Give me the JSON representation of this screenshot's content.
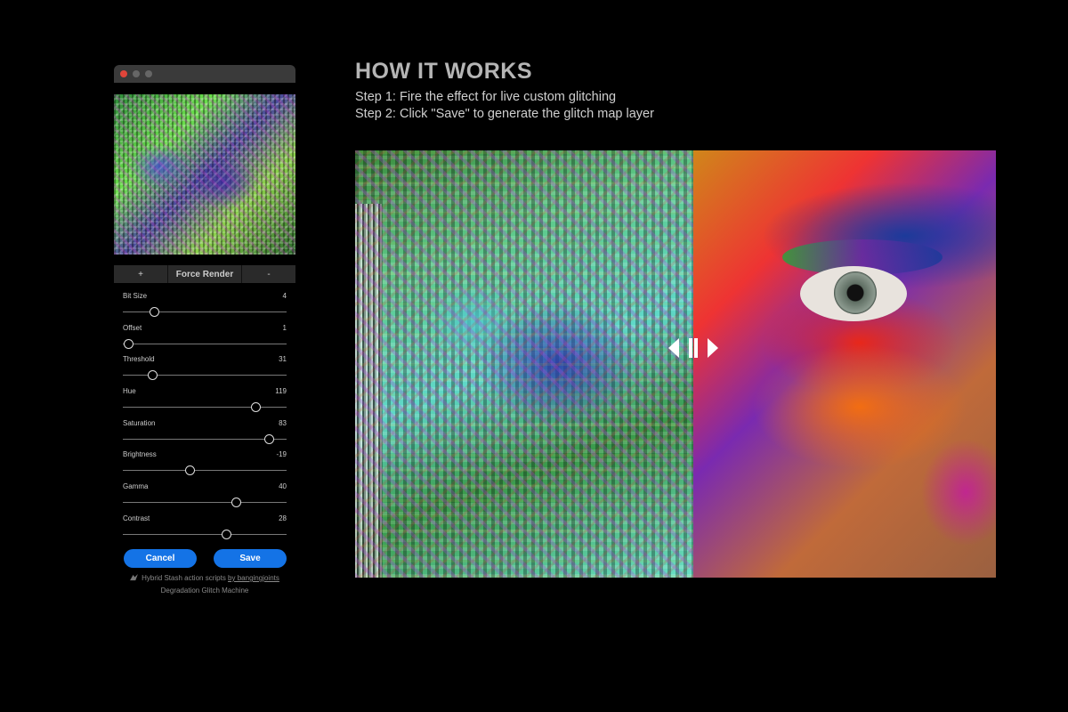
{
  "dialog": {
    "render_bar": {
      "plus": "+",
      "force": "Force Render",
      "minus": "-"
    },
    "sliders": [
      {
        "label": "Bit Size",
        "value": "4",
        "position": 0.19
      },
      {
        "label": "Offset",
        "value": "1",
        "position": 0.03
      },
      {
        "label": "Threshold",
        "value": "31",
        "position": 0.18
      },
      {
        "label": "Hue",
        "value": "119",
        "position": 0.81
      },
      {
        "label": "Saturation",
        "value": "83",
        "position": 0.89
      },
      {
        "label": "Brightness",
        "value": "-19",
        "position": 0.41
      },
      {
        "label": "Gamma",
        "value": "40",
        "position": 0.69
      },
      {
        "label": "Contrast",
        "value": "28",
        "position": 0.63
      }
    ],
    "cancel_label": "Cancel",
    "save_label": "Save",
    "credit_prefix": "Hybrid Stash action scripts",
    "credit_link": "by bangingjoints",
    "credit_product": "Degradation Glitch Machine"
  },
  "content": {
    "heading": "HOW IT WORKS",
    "step1": "Step 1: Fire the effect for live custom glitching",
    "step2": "Step 2: Click \"Save\" to generate the glitch map layer"
  },
  "colors": {
    "accent": "#1473e6",
    "close": "#e0453a"
  }
}
